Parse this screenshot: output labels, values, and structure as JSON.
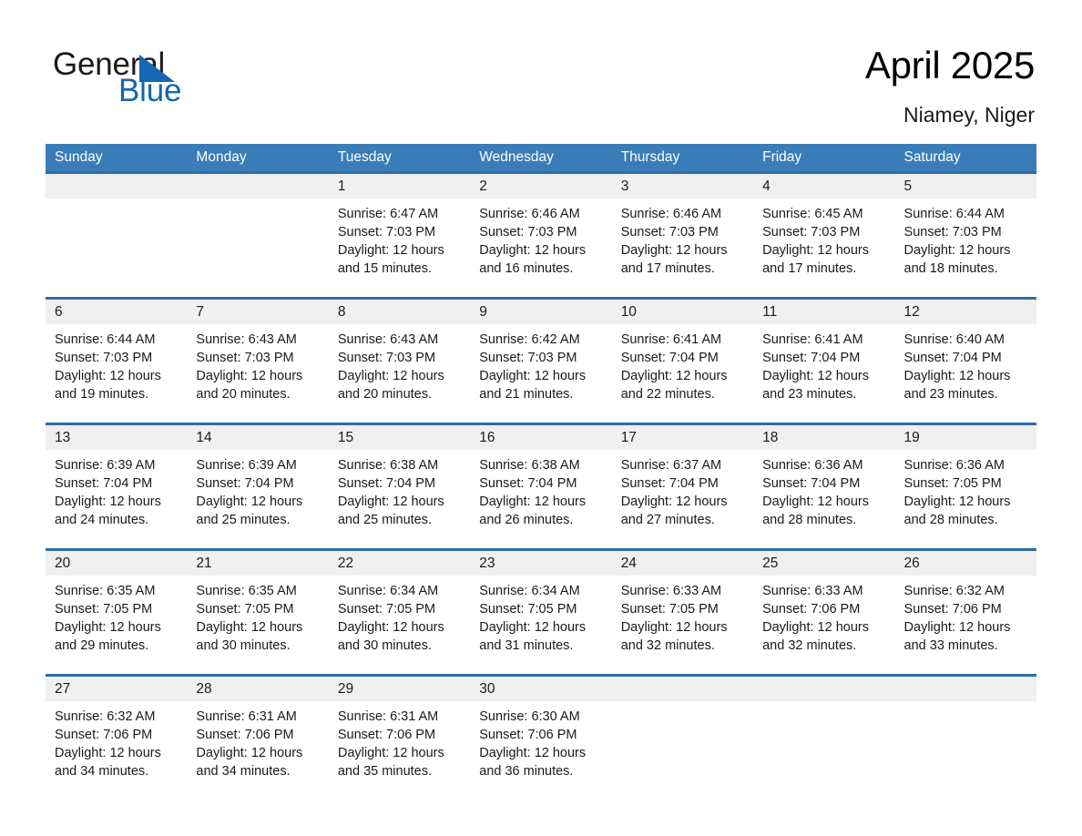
{
  "brand": {
    "name_part1": "General",
    "name_part2": "Blue",
    "logo_icon": "triangle-icon",
    "accent_color": "#1367b0"
  },
  "header": {
    "title": "April 2025",
    "subtitle": "Niamey, Niger"
  },
  "calendar": {
    "header_bg": "#3a7cb8",
    "row_divider_color": "#2e6da4",
    "daynum_bg": "#f0f0f0",
    "weekdays": [
      "Sunday",
      "Monday",
      "Tuesday",
      "Wednesday",
      "Thursday",
      "Friday",
      "Saturday"
    ],
    "weeks": [
      [
        {
          "day": "",
          "l1": "",
          "l2": "",
          "l3": "",
          "l4": ""
        },
        {
          "day": "",
          "l1": "",
          "l2": "",
          "l3": "",
          "l4": ""
        },
        {
          "day": "1",
          "l1": "Sunrise: 6:47 AM",
          "l2": "Sunset: 7:03 PM",
          "l3": "Daylight: 12 hours",
          "l4": "and 15 minutes."
        },
        {
          "day": "2",
          "l1": "Sunrise: 6:46 AM",
          "l2": "Sunset: 7:03 PM",
          "l3": "Daylight: 12 hours",
          "l4": "and 16 minutes."
        },
        {
          "day": "3",
          "l1": "Sunrise: 6:46 AM",
          "l2": "Sunset: 7:03 PM",
          "l3": "Daylight: 12 hours",
          "l4": "and 17 minutes."
        },
        {
          "day": "4",
          "l1": "Sunrise: 6:45 AM",
          "l2": "Sunset: 7:03 PM",
          "l3": "Daylight: 12 hours",
          "l4": "and 17 minutes."
        },
        {
          "day": "5",
          "l1": "Sunrise: 6:44 AM",
          "l2": "Sunset: 7:03 PM",
          "l3": "Daylight: 12 hours",
          "l4": "and 18 minutes."
        }
      ],
      [
        {
          "day": "6",
          "l1": "Sunrise: 6:44 AM",
          "l2": "Sunset: 7:03 PM",
          "l3": "Daylight: 12 hours",
          "l4": "and 19 minutes."
        },
        {
          "day": "7",
          "l1": "Sunrise: 6:43 AM",
          "l2": "Sunset: 7:03 PM",
          "l3": "Daylight: 12 hours",
          "l4": "and 20 minutes."
        },
        {
          "day": "8",
          "l1": "Sunrise: 6:43 AM",
          "l2": "Sunset: 7:03 PM",
          "l3": "Daylight: 12 hours",
          "l4": "and 20 minutes."
        },
        {
          "day": "9",
          "l1": "Sunrise: 6:42 AM",
          "l2": "Sunset: 7:03 PM",
          "l3": "Daylight: 12 hours",
          "l4": "and 21 minutes."
        },
        {
          "day": "10",
          "l1": "Sunrise: 6:41 AM",
          "l2": "Sunset: 7:04 PM",
          "l3": "Daylight: 12 hours",
          "l4": "and 22 minutes."
        },
        {
          "day": "11",
          "l1": "Sunrise: 6:41 AM",
          "l2": "Sunset: 7:04 PM",
          "l3": "Daylight: 12 hours",
          "l4": "and 23 minutes."
        },
        {
          "day": "12",
          "l1": "Sunrise: 6:40 AM",
          "l2": "Sunset: 7:04 PM",
          "l3": "Daylight: 12 hours",
          "l4": "and 23 minutes."
        }
      ],
      [
        {
          "day": "13",
          "l1": "Sunrise: 6:39 AM",
          "l2": "Sunset: 7:04 PM",
          "l3": "Daylight: 12 hours",
          "l4": "and 24 minutes."
        },
        {
          "day": "14",
          "l1": "Sunrise: 6:39 AM",
          "l2": "Sunset: 7:04 PM",
          "l3": "Daylight: 12 hours",
          "l4": "and 25 minutes."
        },
        {
          "day": "15",
          "l1": "Sunrise: 6:38 AM",
          "l2": "Sunset: 7:04 PM",
          "l3": "Daylight: 12 hours",
          "l4": "and 25 minutes."
        },
        {
          "day": "16",
          "l1": "Sunrise: 6:38 AM",
          "l2": "Sunset: 7:04 PM",
          "l3": "Daylight: 12 hours",
          "l4": "and 26 minutes."
        },
        {
          "day": "17",
          "l1": "Sunrise: 6:37 AM",
          "l2": "Sunset: 7:04 PM",
          "l3": "Daylight: 12 hours",
          "l4": "and 27 minutes."
        },
        {
          "day": "18",
          "l1": "Sunrise: 6:36 AM",
          "l2": "Sunset: 7:04 PM",
          "l3": "Daylight: 12 hours",
          "l4": "and 28 minutes."
        },
        {
          "day": "19",
          "l1": "Sunrise: 6:36 AM",
          "l2": "Sunset: 7:05 PM",
          "l3": "Daylight: 12 hours",
          "l4": "and 28 minutes."
        }
      ],
      [
        {
          "day": "20",
          "l1": "Sunrise: 6:35 AM",
          "l2": "Sunset: 7:05 PM",
          "l3": "Daylight: 12 hours",
          "l4": "and 29 minutes."
        },
        {
          "day": "21",
          "l1": "Sunrise: 6:35 AM",
          "l2": "Sunset: 7:05 PM",
          "l3": "Daylight: 12 hours",
          "l4": "and 30 minutes."
        },
        {
          "day": "22",
          "l1": "Sunrise: 6:34 AM",
          "l2": "Sunset: 7:05 PM",
          "l3": "Daylight: 12 hours",
          "l4": "and 30 minutes."
        },
        {
          "day": "23",
          "l1": "Sunrise: 6:34 AM",
          "l2": "Sunset: 7:05 PM",
          "l3": "Daylight: 12 hours",
          "l4": "and 31 minutes."
        },
        {
          "day": "24",
          "l1": "Sunrise: 6:33 AM",
          "l2": "Sunset: 7:05 PM",
          "l3": "Daylight: 12 hours",
          "l4": "and 32 minutes."
        },
        {
          "day": "25",
          "l1": "Sunrise: 6:33 AM",
          "l2": "Sunset: 7:06 PM",
          "l3": "Daylight: 12 hours",
          "l4": "and 32 minutes."
        },
        {
          "day": "26",
          "l1": "Sunrise: 6:32 AM",
          "l2": "Sunset: 7:06 PM",
          "l3": "Daylight: 12 hours",
          "l4": "and 33 minutes."
        }
      ],
      [
        {
          "day": "27",
          "l1": "Sunrise: 6:32 AM",
          "l2": "Sunset: 7:06 PM",
          "l3": "Daylight: 12 hours",
          "l4": "and 34 minutes."
        },
        {
          "day": "28",
          "l1": "Sunrise: 6:31 AM",
          "l2": "Sunset: 7:06 PM",
          "l3": "Daylight: 12 hours",
          "l4": "and 34 minutes."
        },
        {
          "day": "29",
          "l1": "Sunrise: 6:31 AM",
          "l2": "Sunset: 7:06 PM",
          "l3": "Daylight: 12 hours",
          "l4": "and 35 minutes."
        },
        {
          "day": "30",
          "l1": "Sunrise: 6:30 AM",
          "l2": "Sunset: 7:06 PM",
          "l3": "Daylight: 12 hours",
          "l4": "and 36 minutes."
        },
        {
          "day": "",
          "l1": "",
          "l2": "",
          "l3": "",
          "l4": ""
        },
        {
          "day": "",
          "l1": "",
          "l2": "",
          "l3": "",
          "l4": ""
        },
        {
          "day": "",
          "l1": "",
          "l2": "",
          "l3": "",
          "l4": ""
        }
      ]
    ]
  }
}
